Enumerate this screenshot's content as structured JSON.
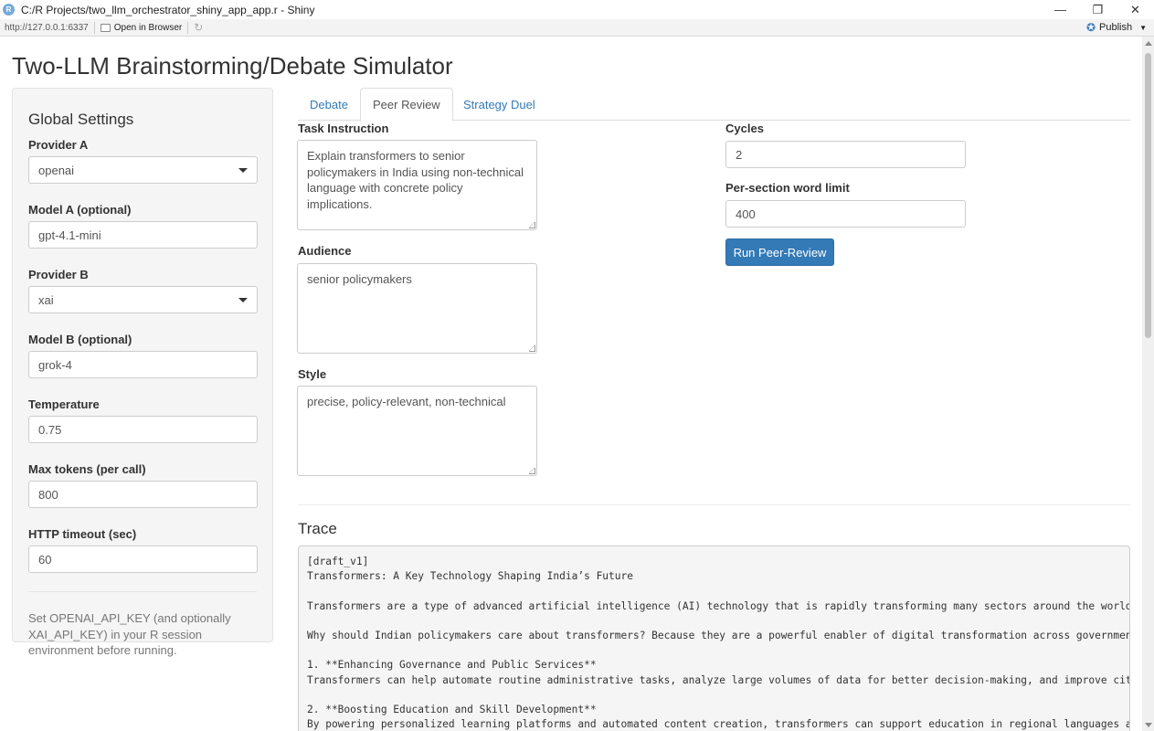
{
  "window": {
    "title": "C:/R Projects/two_llm_orchestrator_shiny_app_app.r - Shiny",
    "minimize": "—",
    "maximize": "❐",
    "close": "✕"
  },
  "toolbar": {
    "url": "http://127.0.0.1:6337",
    "open_in_browser": "Open in Browser",
    "publish": "Publish"
  },
  "app": {
    "title": "Two-LLM Brainstorming/Debate Simulator"
  },
  "sidebar": {
    "heading": "Global Settings",
    "provider_a": {
      "label": "Provider A",
      "value": "openai"
    },
    "model_a": {
      "label": "Model A (optional)",
      "value": "gpt-4.1-mini"
    },
    "provider_b": {
      "label": "Provider B",
      "value": "xai"
    },
    "model_b": {
      "label": "Model B (optional)",
      "value": "grok-4"
    },
    "temperature": {
      "label": "Temperature",
      "value": "0.75"
    },
    "max_tokens": {
      "label": "Max tokens (per call)",
      "value": "800"
    },
    "http_timeout": {
      "label": "HTTP timeout (sec)",
      "value": "60"
    },
    "note": "Set OPENAI_API_KEY (and optionally XAI_API_KEY) in your R session environment before running."
  },
  "tabs": [
    {
      "label": "Debate",
      "active": false
    },
    {
      "label": "Peer Review",
      "active": true
    },
    {
      "label": "Strategy Duel",
      "active": false
    }
  ],
  "peer_review": {
    "task_instruction": {
      "label": "Task Instruction",
      "value": "Explain transformers to senior policymakers in India using non-technical language with concrete policy implications."
    },
    "audience": {
      "label": "Audience",
      "value": "senior policymakers"
    },
    "style": {
      "label": "Style",
      "value": "precise, policy-relevant, non-technical"
    },
    "cycles": {
      "label": "Cycles",
      "value": "2"
    },
    "word_limit": {
      "label": "Per-section word limit",
      "value": "400"
    },
    "run_button": "Run Peer-Review"
  },
  "trace": {
    "heading": "Trace",
    "lines": [
      "[draft_v1]",
      "Transformers: A Key Technology Shaping India’s Future",
      "",
      "Transformers are a type of advanced artificial intelligence (AI) technology that is rapidly transforming many sectors around the world. At their",
      "",
      "Why should Indian policymakers care about transformers? Because they are a powerful enabler of digital transformation across government, busines",
      "",
      "1. **Enhancing Governance and Public Services**",
      "Transformers can help automate routine administrative tasks, analyze large volumes of data for better decision-making, and improve citizen engag",
      "",
      "2. **Boosting Education and Skill Development**",
      "By powering personalized learning platforms and automated content creation, transformers can support education in regional languages and help br"
    ]
  }
}
